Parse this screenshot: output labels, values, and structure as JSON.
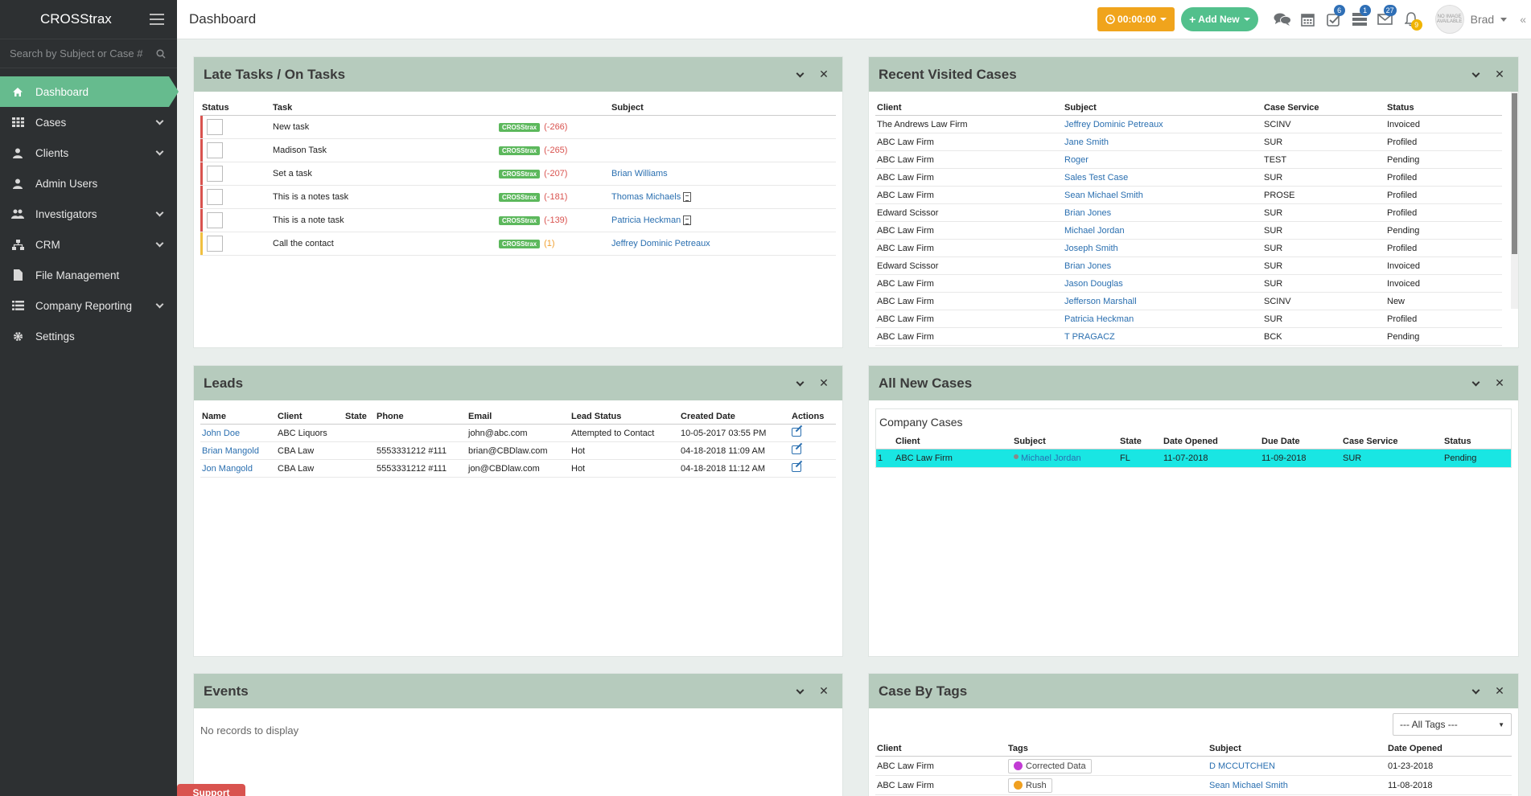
{
  "app": {
    "brand": "CROSStrax",
    "page_title": "Dashboard"
  },
  "sidebar": {
    "search_placeholder": "Search by Subject or Case #",
    "items": [
      {
        "label": "Dashboard",
        "icon": "home-icon"
      },
      {
        "label": "Cases",
        "icon": "grid-icon"
      },
      {
        "label": "Clients",
        "icon": "user-icon"
      },
      {
        "label": "Admin Users",
        "icon": "user-icon"
      },
      {
        "label": "Investigators",
        "icon": "users-icon"
      },
      {
        "label": "CRM",
        "icon": "org-icon"
      },
      {
        "label": "File Management",
        "icon": "file-icon"
      },
      {
        "label": "Company Reporting",
        "icon": "list-icon"
      },
      {
        "label": "Settings",
        "icon": "gear-icon"
      }
    ]
  },
  "topbar": {
    "timer": "00:00:00",
    "add_new": "Add New",
    "badges": {
      "tasks": "6",
      "list": "1",
      "mail": "27",
      "bell": "9"
    },
    "user_name": "Brad",
    "avatar_text": "NO IMAGE AVAILABLE"
  },
  "late_tasks": {
    "title": "Late Tasks / On Tasks",
    "headers": [
      "Status",
      "Task",
      "Subject"
    ],
    "tag_label": "CROSStrax",
    "rows": [
      {
        "task": "New task",
        "late": "(-266)",
        "subject": "",
        "doc": false,
        "color": "red"
      },
      {
        "task": "Madison Task",
        "late": "(-265)",
        "subject": "",
        "doc": false,
        "color": "red"
      },
      {
        "task": "Set a task",
        "late": "(-207)",
        "subject": "Brian Williams",
        "doc": false,
        "color": "red"
      },
      {
        "task": "This is a notes task",
        "late": "(-181)",
        "subject": "Thomas Michaels",
        "doc": true,
        "color": "red"
      },
      {
        "task": "This is a note task",
        "late": "(-139)",
        "subject": "Patricia Heckman",
        "doc": true,
        "color": "red"
      },
      {
        "task": "Call the contact",
        "late": "(1)",
        "subject": "Jeffrey Dominic Petreaux",
        "doc": false,
        "color": "yellow"
      }
    ]
  },
  "recent_cases": {
    "title": "Recent Visited Cases",
    "headers": [
      "Client",
      "Subject",
      "Case Service",
      "Status"
    ],
    "rows": [
      [
        "The Andrews Law Firm",
        "Jeffrey Dominic Petreaux",
        "SCINV",
        "Invoiced"
      ],
      [
        "ABC Law Firm",
        "Jane Smith",
        "SUR",
        "Profiled"
      ],
      [
        "ABC Law Firm",
        "Roger",
        "TEST",
        "Pending"
      ],
      [
        "ABC Law Firm",
        "Sales Test Case",
        "SUR",
        "Profiled"
      ],
      [
        "ABC Law Firm",
        "Sean Michael Smith",
        "PROSE",
        "Profiled"
      ],
      [
        "Edward Scissor",
        "Brian Jones",
        "SUR",
        "Profiled"
      ],
      [
        "ABC Law Firm",
        "Michael Jordan",
        "SUR",
        "Pending"
      ],
      [
        "ABC Law Firm",
        "Joseph Smith",
        "SUR",
        "Profiled"
      ],
      [
        "Edward Scissor",
        "Brian Jones",
        "SUR",
        "Invoiced"
      ],
      [
        "ABC Law Firm",
        "Jason Douglas",
        "SUR",
        "Invoiced"
      ],
      [
        "ABC Law Firm",
        "Jefferson Marshall",
        "SCINV",
        "New"
      ],
      [
        "ABC Law Firm",
        "Patricia Heckman",
        "SUR",
        "Profiled"
      ],
      [
        "ABC Law Firm",
        "T PRAGACZ",
        "BCK",
        "Pending"
      ]
    ]
  },
  "leads": {
    "title": "Leads",
    "headers": [
      "Name",
      "Client",
      "State",
      "Phone",
      "Email",
      "Lead Status",
      "Created Date",
      "Actions"
    ],
    "rows": [
      [
        "John Doe",
        "ABC Liquors",
        "",
        "",
        "john@abc.com",
        "Attempted to Contact",
        "10-05-2017 03:55 PM"
      ],
      [
        "Brian Mangold",
        "CBA Law",
        "",
        "5553331212 #111",
        "brian@CBDlaw.com",
        "Hot",
        "04-18-2018 11:09 AM"
      ],
      [
        "Jon Mangold",
        "CBA Law",
        "",
        "5553331212 #111",
        "jon@CBDlaw.com",
        "Hot",
        "04-18-2018 11:12 AM"
      ]
    ]
  },
  "new_cases": {
    "title": "All New Cases",
    "sub_title": "Company Cases",
    "headers": [
      "",
      "Client",
      "Subject",
      "State",
      "Date Opened",
      "Due Date",
      "Case Service",
      "Status"
    ],
    "rows": [
      [
        "1",
        "ABC Law Firm",
        "Michael Jordan",
        "FL",
        "11-07-2018",
        "11-09-2018",
        "SUR",
        "Pending"
      ]
    ]
  },
  "events": {
    "title": "Events",
    "empty_text": "No records to display"
  },
  "case_tags": {
    "title": "Case By Tags",
    "filter": "--- All Tags ---",
    "headers": [
      "Client",
      "Tags",
      "Subject",
      "Date Opened"
    ],
    "rows": [
      {
        "client": "ABC Law Firm",
        "tag": "Corrected Data",
        "tag_color": "#c23bd4",
        "subject": "D MCCUTCHEN",
        "date": "01-23-2018"
      },
      {
        "client": "ABC Law Firm",
        "tag": "Rush",
        "tag_color": "#f0a020",
        "subject": "Sean Michael Smith",
        "date": "11-08-2018"
      }
    ]
  },
  "support": {
    "label": "Support"
  },
  "colors": {
    "accent": "#66bb8e",
    "panel_header": "#b6cbbd",
    "timer": "#f0a41c",
    "highlight": "#19e6e3"
  }
}
